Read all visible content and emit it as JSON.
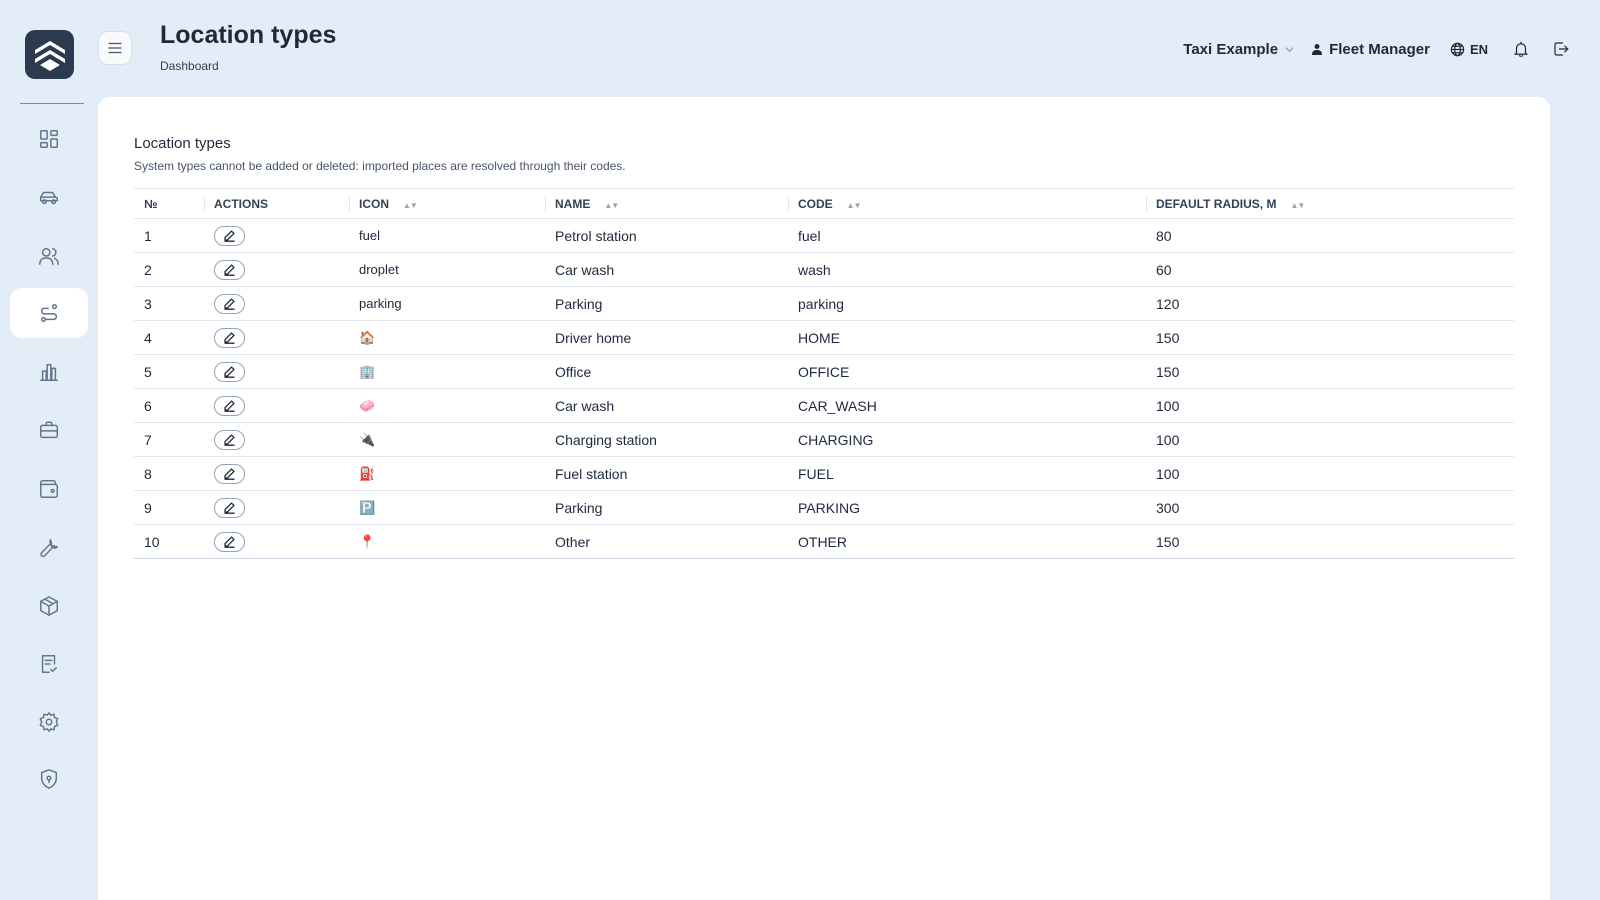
{
  "header": {
    "title": "Location types",
    "breadcrumb": "Dashboard",
    "company": "Taxi Example",
    "user_role": "Fleet Manager",
    "language": "EN"
  },
  "sidebar": {
    "items": [
      {
        "name": "dashboard-icon",
        "active": false
      },
      {
        "name": "car-icon",
        "active": false
      },
      {
        "name": "users-icon",
        "active": false
      },
      {
        "name": "route-icon",
        "active": true
      },
      {
        "name": "chart-icon",
        "active": false
      },
      {
        "name": "briefcase-icon",
        "active": false
      },
      {
        "name": "wallet-icon",
        "active": false
      },
      {
        "name": "wrench-icon",
        "active": false
      },
      {
        "name": "package-icon",
        "active": false
      },
      {
        "name": "checklist-icon",
        "active": false
      },
      {
        "name": "gear-icon",
        "active": false
      },
      {
        "name": "shield-icon",
        "active": false
      }
    ]
  },
  "section": {
    "title": "Location types",
    "subtitle": "System types cannot be added or deleted: imported places are resolved through their codes."
  },
  "table": {
    "columns": [
      "№",
      "ACTIONS",
      "ICON",
      "NAME",
      "CODE",
      "DEFAULT RADIUS, M"
    ],
    "rows": [
      {
        "num": "1",
        "icon": "fuel",
        "name": "Petrol station",
        "code": "fuel",
        "radius": "80"
      },
      {
        "num": "2",
        "icon": "droplet",
        "name": "Car wash",
        "code": "wash",
        "radius": "60"
      },
      {
        "num": "3",
        "icon": "parking",
        "name": "Parking",
        "code": "parking",
        "radius": "120"
      },
      {
        "num": "4",
        "icon": "🏠",
        "name": "Driver home",
        "code": "HOME",
        "radius": "150"
      },
      {
        "num": "5",
        "icon": "🏢",
        "name": "Office",
        "code": "OFFICE",
        "radius": "150"
      },
      {
        "num": "6",
        "icon": "🧼",
        "name": "Car wash",
        "code": "CAR_WASH",
        "radius": "100"
      },
      {
        "num": "7",
        "icon": "🔌",
        "name": "Charging station",
        "code": "CHARGING",
        "radius": "100"
      },
      {
        "num": "8",
        "icon": "⛽",
        "name": "Fuel station",
        "code": "FUEL",
        "radius": "100"
      },
      {
        "num": "9",
        "icon": "🅿️",
        "name": "Parking",
        "code": "PARKING",
        "radius": "300"
      },
      {
        "num": "10",
        "icon": "📍",
        "name": "Other",
        "code": "OTHER",
        "radius": "150"
      }
    ]
  },
  "colors": {
    "background": "#e3edf7",
    "card": "#ffffff",
    "logo": "#2b3a4f",
    "text": "#1e293b"
  }
}
